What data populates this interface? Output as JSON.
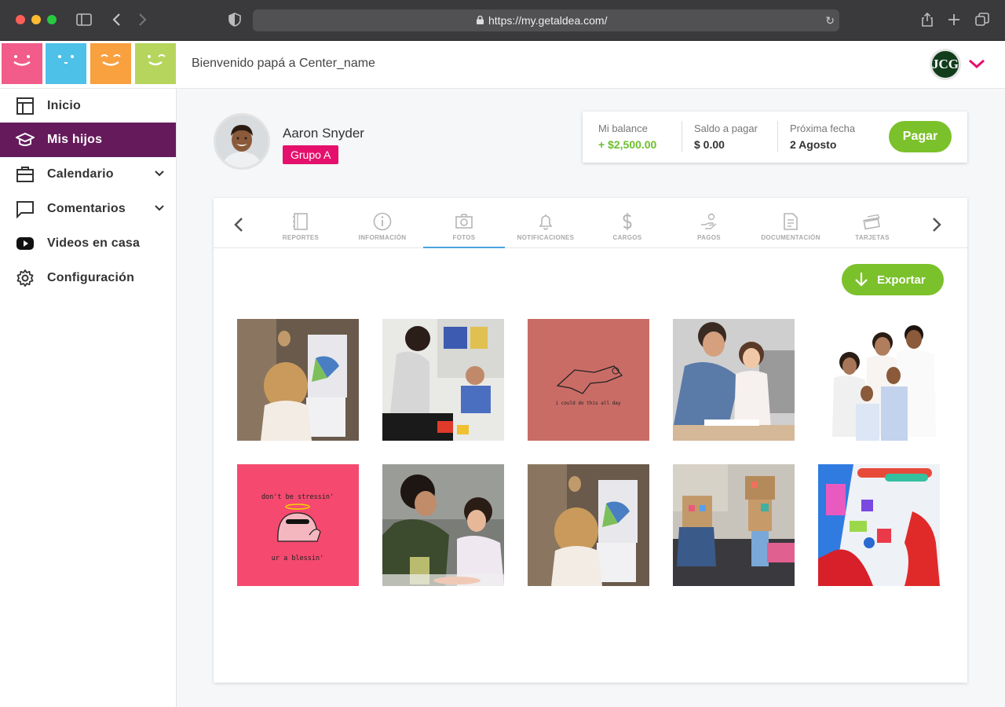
{
  "browser": {
    "url": "https://my.getaldea.com/"
  },
  "header": {
    "welcome": "Bienvenido papá a Center_name",
    "user_initials": "JCG"
  },
  "brand_colors": {
    "tile_pink": "#f15c8a",
    "tile_blue": "#4ec1e9",
    "tile_orange": "#f9a03f",
    "tile_green": "#b6d55c",
    "active_nav": "#651a5b",
    "primary_green": "#7bc12b",
    "badge_pink": "#e5106c"
  },
  "sidebar": {
    "items": [
      {
        "label": "Inicio",
        "icon": "layout-icon"
      },
      {
        "label": "Mis hijos",
        "icon": "graduation-cap-icon",
        "active": true
      },
      {
        "label": "Calendario",
        "icon": "briefcase-icon",
        "expandable": true
      },
      {
        "label": "Comentarios",
        "icon": "chat-bubble-icon",
        "expandable": true
      },
      {
        "label": "Videos en casa",
        "icon": "youtube-icon"
      },
      {
        "label": "Configuración",
        "icon": "gear-icon"
      }
    ]
  },
  "profile": {
    "name": "Aaron Snyder",
    "group": "Grupo A"
  },
  "balance": {
    "balance_label": "Mi balance",
    "balance_value": "+ $2,500.00",
    "due_label": "Saldo a pagar",
    "due_value": "$ 0.00",
    "next_label": "Próxima fecha",
    "next_value": "2 Agosto",
    "pay_button": "Pagar"
  },
  "tabs": [
    {
      "label": "REPORTES",
      "icon": "notebook-icon"
    },
    {
      "label": "INFORMACIÓN",
      "icon": "info-icon"
    },
    {
      "label": "FOTOS",
      "icon": "camera-icon",
      "active": true
    },
    {
      "label": "NOTIFICACIONES",
      "icon": "bell-icon"
    },
    {
      "label": "CARGOS",
      "icon": "dollar-icon"
    },
    {
      "label": "PAGOS",
      "icon": "hand-coin-icon"
    },
    {
      "label": "DOCUMENTACIÓN",
      "icon": "document-icon"
    },
    {
      "label": "TARJETAS",
      "icon": "card-icon"
    }
  ],
  "gallery": {
    "export_button": "Exportar",
    "sketch_text_1": "i could do this all day",
    "sticker_top": "don't be stressin'",
    "sticker_bottom": "ur a blessin'"
  }
}
